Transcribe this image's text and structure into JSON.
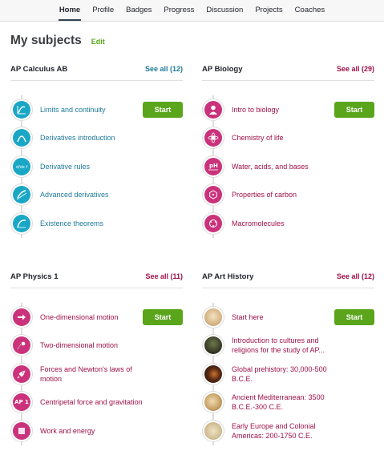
{
  "nav": {
    "items": [
      "Home",
      "Profile",
      "Badges",
      "Progress",
      "Discussion",
      "Projects",
      "Coaches"
    ],
    "active": "Home"
  },
  "page": {
    "title": "My subjects",
    "edit_label": "Edit"
  },
  "start_label": "Start",
  "subjects": [
    {
      "name": "AP Calculus AB",
      "see_all": "See all (12)",
      "items": [
        {
          "label": "Limits and continuity",
          "icon": "limit-graph-icon"
        },
        {
          "label": "Derivatives introduction",
          "icon": "tangent-curve-icon"
        },
        {
          "label": "Derivative rules",
          "icon": "formula-icon"
        },
        {
          "label": "Advanced derivatives",
          "icon": "tangent-line-icon"
        },
        {
          "label": "Existence theorems",
          "icon": "curve-icon"
        }
      ]
    },
    {
      "name": "AP Biology",
      "see_all": "See all (29)",
      "items": [
        {
          "label": "Intro to biology",
          "icon": "person-icon"
        },
        {
          "label": "Chemistry of life",
          "icon": "atom-icon"
        },
        {
          "label": "Water, acids, and bases",
          "icon": "ph-icon"
        },
        {
          "label": "Properties of carbon",
          "icon": "carbon-ring-icon"
        },
        {
          "label": "Macromolecules",
          "icon": "molecule-icon"
        }
      ]
    },
    {
      "name": "AP Physics 1",
      "see_all": "See all (11)",
      "items": [
        {
          "label": "One-dimensional motion",
          "icon": "arrow-right-icon"
        },
        {
          "label": "Two-dimensional motion",
          "icon": "ball-icon"
        },
        {
          "label": "Forces and Newton's laws of motion",
          "icon": "rocket-icon"
        },
        {
          "label": "Centripetal force and gravitation",
          "icon": "ap1-icon",
          "icon_text": "AP 1"
        },
        {
          "label": "Work and energy",
          "icon": "box-icon"
        }
      ]
    },
    {
      "name": "AP Art History",
      "see_all": "See all (12)",
      "items": [
        {
          "label": "Start here",
          "icon": "artwork-thumbnail-icon"
        },
        {
          "label": "Introduction to cultures and religions for the study of AP...",
          "icon": "mask-thumbnail-icon"
        },
        {
          "label": "Global prehistory: 30,000-500 B.C.E.",
          "icon": "figurine-thumbnail-icon"
        },
        {
          "label": "Ancient Mediterranean: 3500 B.C.E.-300 C.E.",
          "icon": "relief-thumbnail-icon"
        },
        {
          "label": "Early Europe and Colonial Americas: 200-1750 C.E.",
          "icon": "manuscript-thumbnail-icon"
        }
      ]
    }
  ],
  "colors": {
    "math_accent": "#1aa7c6",
    "math_text": "#1e7a9a",
    "science_accent": "#ca337c",
    "science_text": "#9e1048",
    "start_button": "#5aa51c"
  }
}
